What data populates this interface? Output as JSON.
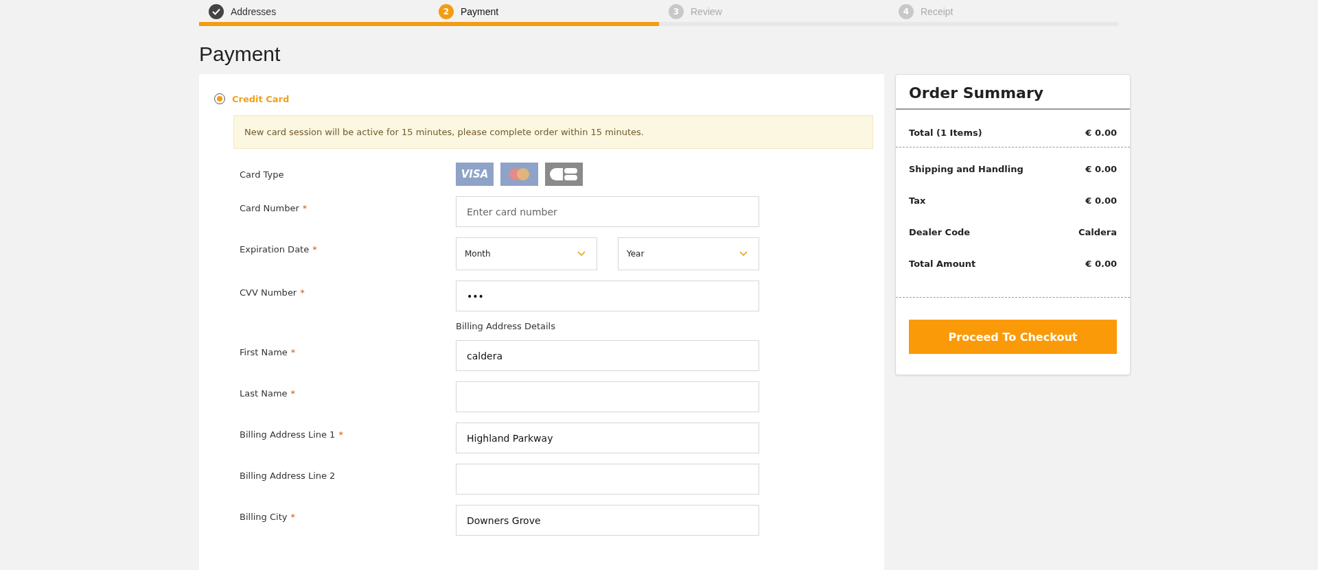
{
  "steps": [
    {
      "label": "Addresses",
      "completed": true,
      "selected": false
    },
    {
      "number": "2",
      "label": "Payment",
      "completed": false,
      "selected": true
    },
    {
      "number": "3",
      "label": "Review",
      "completed": false,
      "selected": false
    },
    {
      "number": "4",
      "label": "Receipt",
      "completed": false,
      "selected": false
    }
  ],
  "progress": {
    "level": 0.5
  },
  "page_title": "Payment",
  "payment_method": {
    "label": "Credit Card",
    "selected": true
  },
  "notice": "New card session will be active for 15 minutes, please complete order within 15 minutes.",
  "card_type": {
    "label": "Card Type",
    "cards": [
      {
        "kind": "visa",
        "label": "VISA"
      },
      {
        "kind": "mastercard"
      },
      {
        "kind": "cb"
      }
    ]
  },
  "fields": [
    {
      "kind": "text",
      "label": "Card Number",
      "required_mark": "*",
      "placeholder": "Enter card number"
    },
    {
      "kind": "selects",
      "label": "Expiration Date",
      "required_mark": "*",
      "options": [
        "Month",
        "Year"
      ]
    },
    {
      "kind": "text",
      "label": "CVV Number",
      "required_mark": "*",
      "value": "•••"
    },
    {
      "kind": "heading",
      "label": "Billing Address Details"
    },
    {
      "kind": "text",
      "label": "First Name",
      "required_mark": "*",
      "value": "caldera"
    },
    {
      "kind": "text",
      "label": "Last Name",
      "required_mark": "*"
    },
    {
      "kind": "text",
      "label": "Billing Address Line 1",
      "required_mark": "*",
      "value": "Highland Parkway"
    },
    {
      "kind": "text",
      "label": "Billing Address Line 2"
    },
    {
      "kind": "text",
      "label": "Billing City",
      "required_mark": "*",
      "value": "Downers Grove"
    }
  ],
  "summary": {
    "title": "Order Summary",
    "rows": [
      {
        "label": "Total (1 Items)",
        "value": "€ 0.00"
      },
      {
        "label": "Shipping and Handling",
        "value": "€ 0.00"
      },
      {
        "label": "Tax",
        "value": "€ 0.00"
      },
      {
        "label": "Dealer Code",
        "value": "Caldera"
      },
      {
        "label": "Total Amount",
        "value": "€ 0.00"
      }
    ],
    "button": "Proceed To Checkout"
  }
}
